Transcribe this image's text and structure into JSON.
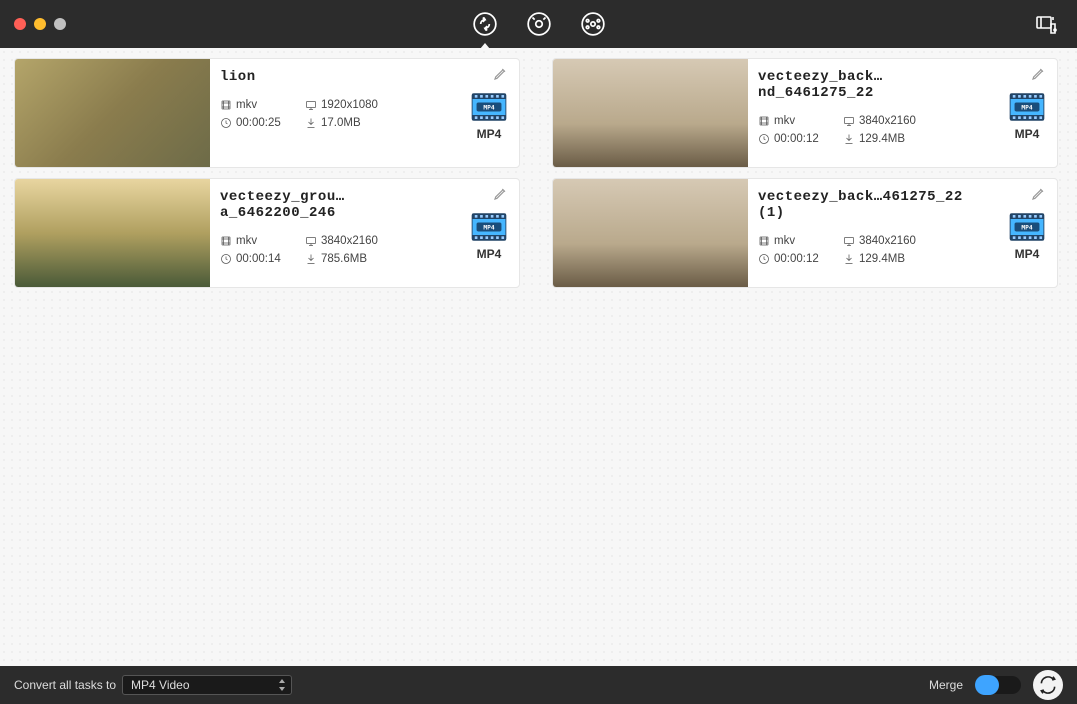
{
  "toolbar": {
    "tabs": [
      "convert",
      "download",
      "dvd"
    ],
    "active_tab": 0
  },
  "videos": [
    {
      "title": "lion",
      "format": "mkv",
      "resolution": "1920x1080",
      "duration": "00:00:25",
      "filesize": "17.0MB",
      "target_format": "MP4",
      "thumb_class": "type-savanna"
    },
    {
      "title": "vecteezy_back…nd_6461275_22",
      "format": "mkv",
      "resolution": "3840x2160",
      "duration": "00:00:12",
      "filesize": "129.4MB",
      "target_format": "MP4",
      "thumb_class": "type-building"
    },
    {
      "title": "vecteezy_grou…a_6462200_246",
      "format": "mkv",
      "resolution": "3840x2160",
      "duration": "00:00:14",
      "filesize": "785.6MB",
      "target_format": "MP4",
      "thumb_class": "type-people"
    },
    {
      "title": "vecteezy_back…461275_22 (1)",
      "format": "mkv",
      "resolution": "3840x2160",
      "duration": "00:00:12",
      "filesize": "129.4MB",
      "target_format": "MP4",
      "thumb_class": "type-building"
    }
  ],
  "bottombar": {
    "convert_all_label": "Convert all tasks to",
    "selected_target": "MP4 Video",
    "merge_label": "Merge",
    "merge_on": false
  }
}
